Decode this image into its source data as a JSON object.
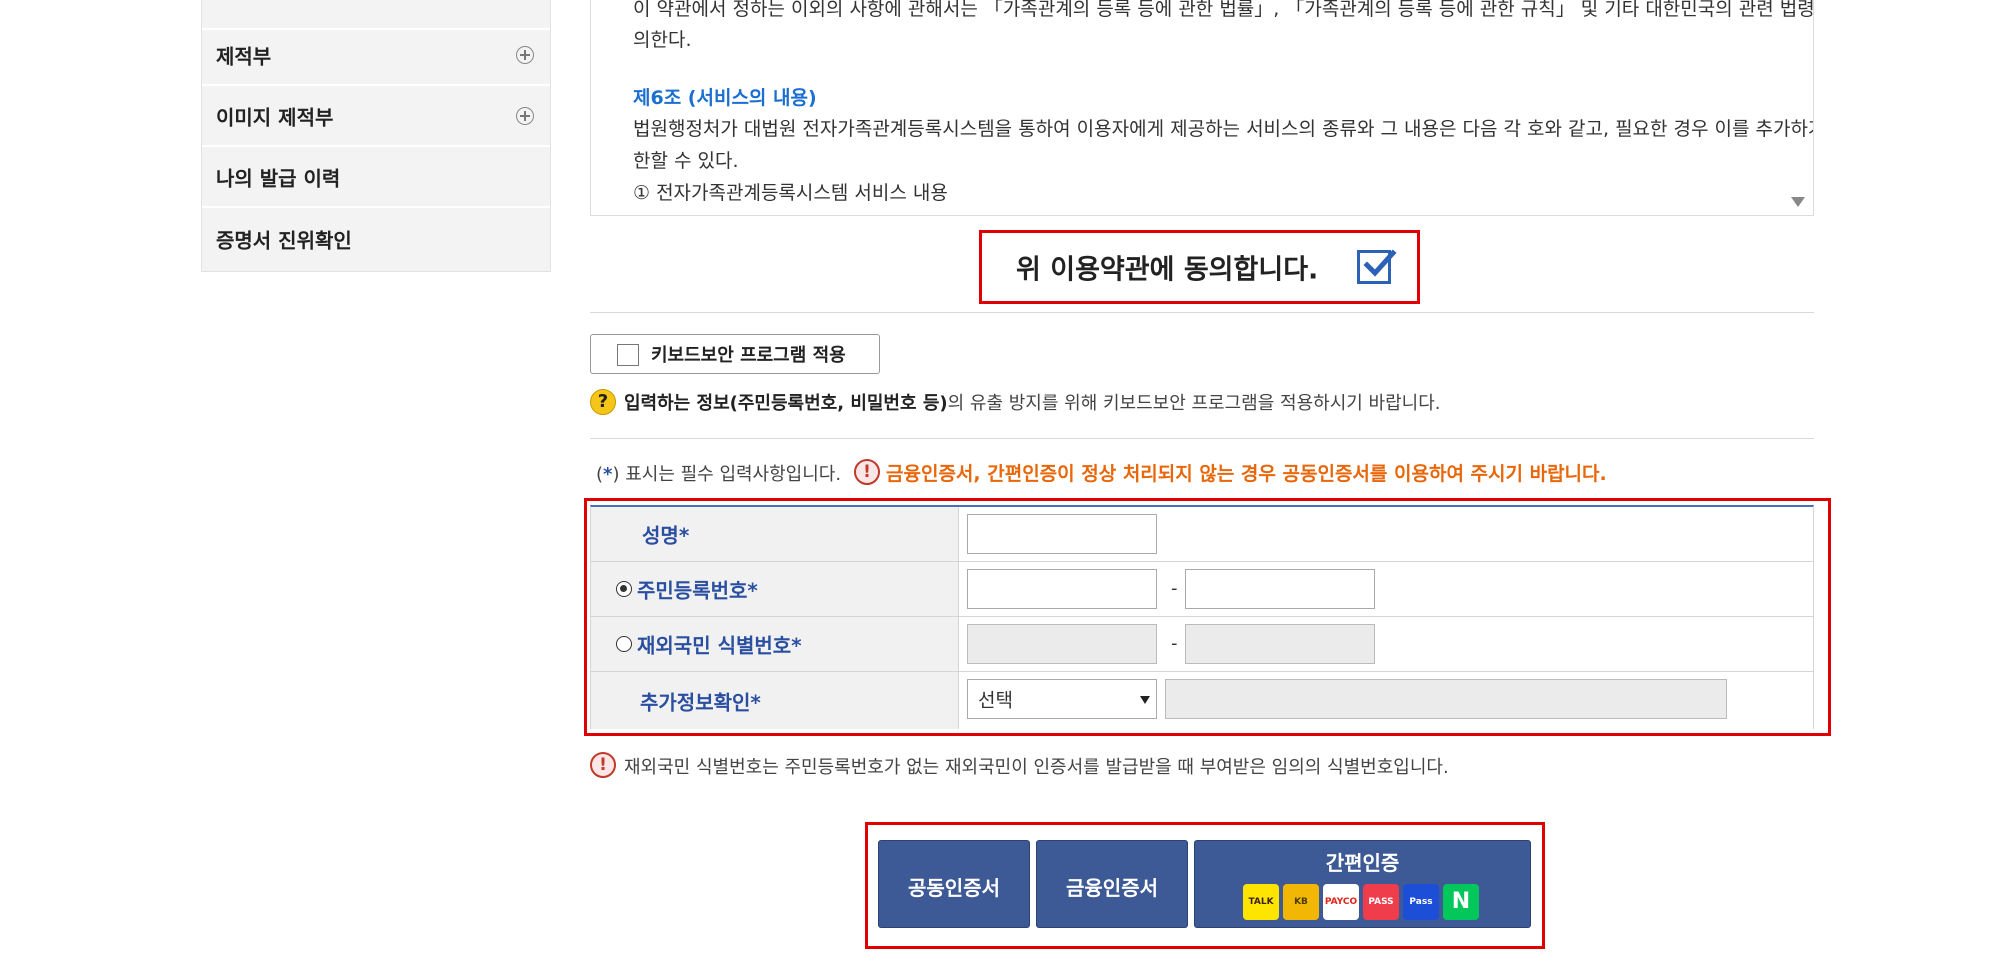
{
  "sidebar": {
    "items": [
      {
        "label": "제적부",
        "expandable": true
      },
      {
        "label": "이미지 제적부",
        "expandable": true
      },
      {
        "label": "나의 발급 이력",
        "expandable": false
      },
      {
        "label": "증명서 진위확인",
        "expandable": false
      }
    ]
  },
  "terms": {
    "line1": "이 약관에서 정하는 이외의 사항에 관해서는 「가족관계의 등록 등에 관한 법률」, 「가족관계의 등록 등에 관한 규칙」 및 기타 대한민국의 관련 법령 및 상관습에",
    "line2": "의한다.",
    "heading": "제6조 (서비스의 내용)",
    "line3": "법원행정처가 대법원 전자가족관계등록시스템을 통하여 이용자에게 제공하는 서비스의 종류와 그 내용은 다음 각 호와 같고, 필요한 경우 이를 추가하거나 제",
    "line4": "한할 수 있다.",
    "line5": "① 전자가족관계등록시스템 서비스 내용"
  },
  "agree": {
    "label": "위 이용약관에 동의합니다.",
    "checked": true
  },
  "keyboard_security": {
    "label": "키보드보안 프로그램 적용",
    "notice_bold": "입력하는 정보(주민등록번호, 비밀번호 등)",
    "notice_rest": "의 유출 방지를 위해 키보드보안 프로그램을 적용하시기 바랍니다."
  },
  "required_notice": {
    "open": "(",
    "star": "*",
    "close": ") 표시는 필수 입력사항입니다.",
    "warning": "금융인증서, 간편인증이 정상 처리되지 않는 경우 공동인증서를 이용하여 주시기 바랍니다."
  },
  "form": {
    "name_label": "성명",
    "rrn_label": "주민등록번호",
    "foreign_label": "재외국민 식별번호",
    "extra_label": "추가정보확인",
    "star": "*",
    "dash": "-",
    "extra_select_value": "선택",
    "rrn_selected": true
  },
  "foreign_notice": "재외국민 식별번호는 주민등록번호가 없는 재외국민이 인증서를 발급받을 때 부여받은 임의의 식별번호입니다.",
  "auth": {
    "joint_cert": "공동인증서",
    "finance_cert": "금융인증서",
    "simple_auth": "간편인증",
    "logos": [
      {
        "name": "kakao",
        "text": "TALK",
        "bg": "#fee500",
        "fg": "#3c1e1e"
      },
      {
        "name": "kb",
        "text": "KB",
        "bg": "#f2b705",
        "fg": "#4a3b00"
      },
      {
        "name": "payco",
        "text": "PAYCO",
        "bg": "#ffffff",
        "fg": "#e2231a"
      },
      {
        "name": "pass",
        "text": "PASS",
        "bg": "#ef3d4b",
        "fg": "#ffffff"
      },
      {
        "name": "samsung-pass",
        "text": "Pass",
        "bg": "#1d4ed8",
        "fg": "#ffffff"
      },
      {
        "name": "naver",
        "text": "N",
        "bg": "#03c75a",
        "fg": "#ffffff"
      }
    ]
  },
  "icons": {
    "help": "?",
    "warning": "!"
  },
  "colors": {
    "accent_blue": "#2a4fa0",
    "button_blue": "#3d5a96",
    "highlight_red": "#e00000",
    "warning_orange": "#e8670a"
  }
}
